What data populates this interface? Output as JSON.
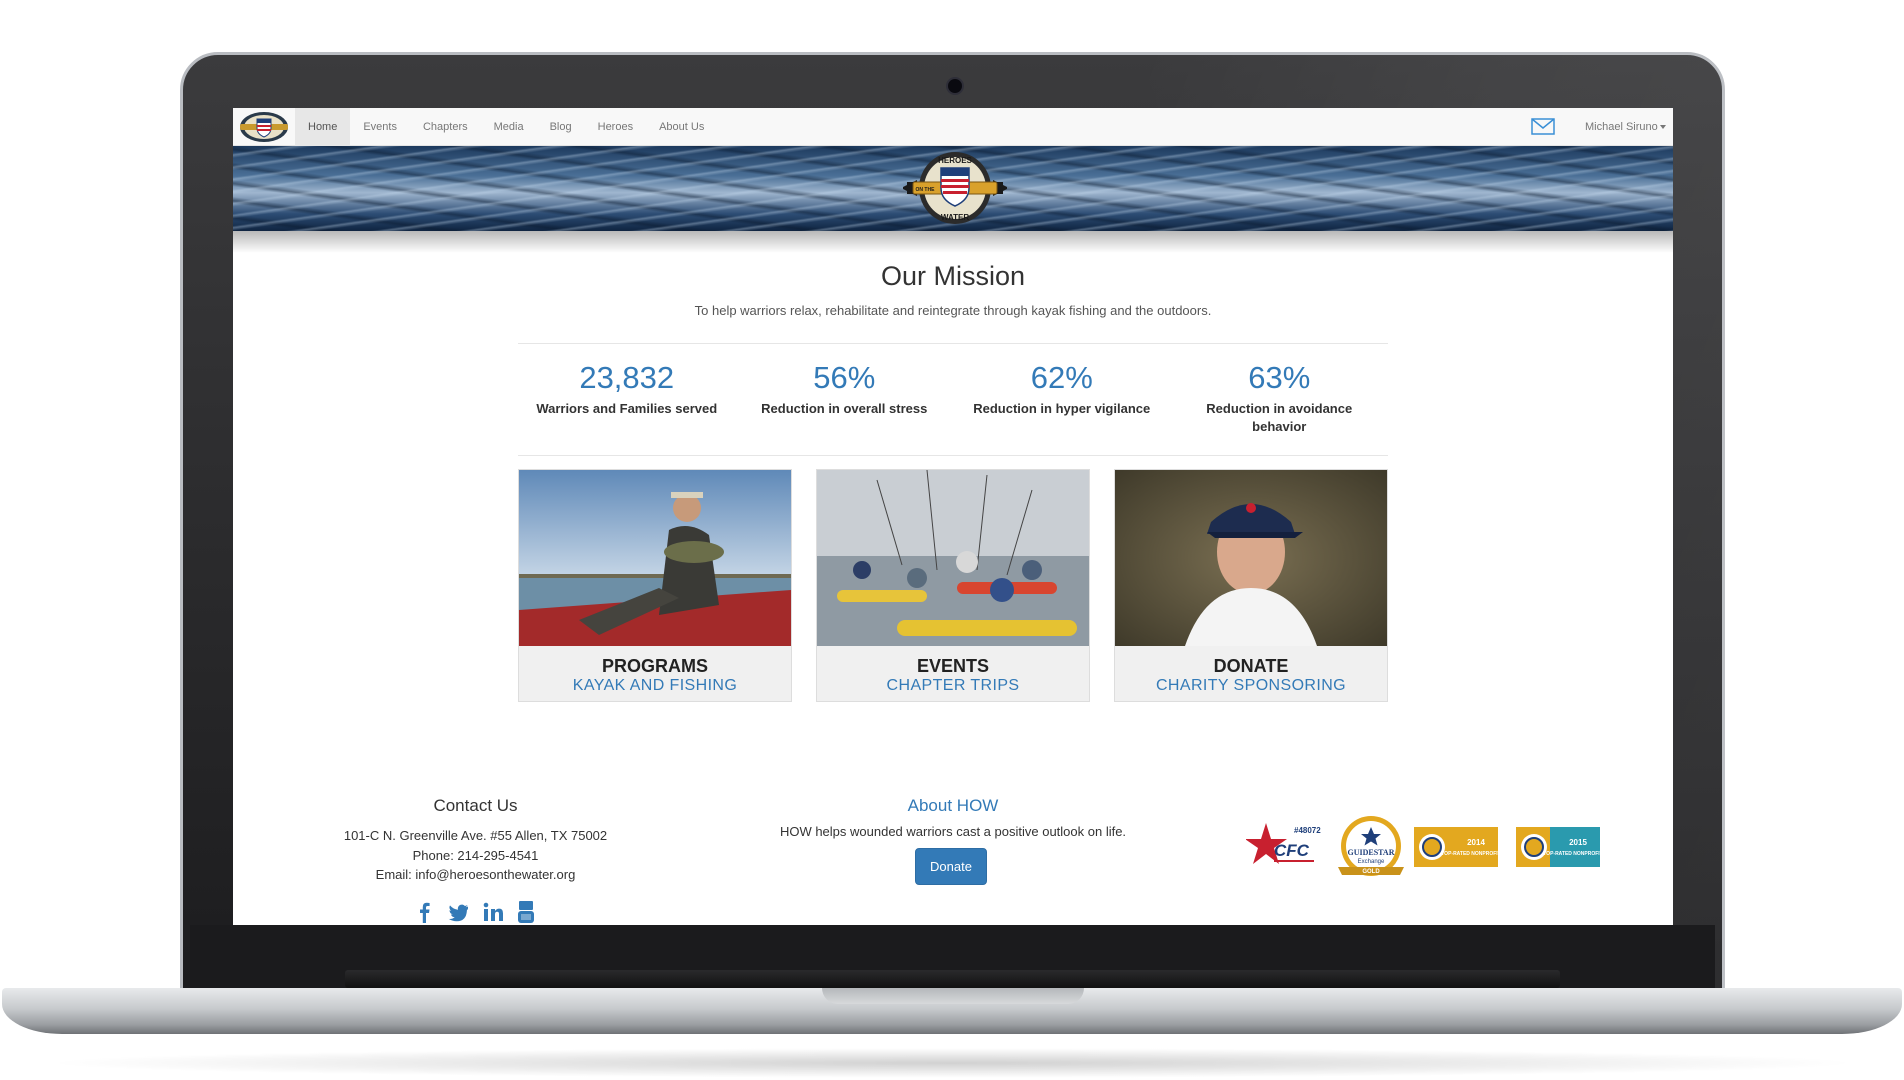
{
  "nav": {
    "items": [
      {
        "label": "Home",
        "active": true
      },
      {
        "label": "Events"
      },
      {
        "label": "Chapters"
      },
      {
        "label": "Media"
      },
      {
        "label": "Blog"
      },
      {
        "label": "Heroes"
      },
      {
        "label": "About Us"
      }
    ],
    "mail_icon": "envelope-icon",
    "user": "Michael Siruno"
  },
  "mission": {
    "title": "Our Mission",
    "subtitle": "To help warriors relax, rehabilitate and reintegrate through kayak fishing and the outdoors."
  },
  "stats": [
    {
      "value": "23,832",
      "label": "Warriors and Families served"
    },
    {
      "value": "56%",
      "label": "Reduction in overall stress"
    },
    {
      "value": "62%",
      "label": "Reduction in hyper vigilance"
    },
    {
      "value": "63%",
      "label": "Reduction in avoidance behavior"
    }
  ],
  "cards": [
    {
      "title": "PROGRAMS",
      "subtitle": "KAYAK AND FISHING"
    },
    {
      "title": "EVENTS",
      "subtitle": "CHAPTER TRIPS"
    },
    {
      "title": "DONATE",
      "subtitle": "CHARITY SPONSORING"
    }
  ],
  "contact": {
    "title": "Contact Us",
    "address": "101-C N. Greenville Ave. #55 Allen, TX 75002",
    "phone": "Phone: 214-295-4541",
    "email": "Email: info@heroesonthewater.org",
    "social_icons": [
      "facebook-icon",
      "twitter-icon",
      "linkedin-icon",
      "youtube-icon"
    ]
  },
  "about": {
    "title": "About HOW",
    "text": "HOW helps wounded warriors cast a positive outlook on life.",
    "donate_label": "Donate"
  },
  "badges": {
    "cfc_number": "#48072",
    "cfc_label": "CFC",
    "guidestar_name": "GUIDESTAR",
    "guidestar_sub": "Exchange",
    "guidestar_level": "GOLD",
    "gn_2014_year": "2014",
    "gn_2014_text": "TOP-RATED NONPROFIT",
    "gn_2015_year": "2015",
    "gn_2015_text": "TOP-RATED NONPROFIT",
    "brand_colors": {
      "primary": "#337ab7",
      "gold": "#e3a81f",
      "teal": "#2a9aae"
    }
  },
  "logo_text": [
    "HEROES",
    "ON THE",
    "WATER"
  ]
}
